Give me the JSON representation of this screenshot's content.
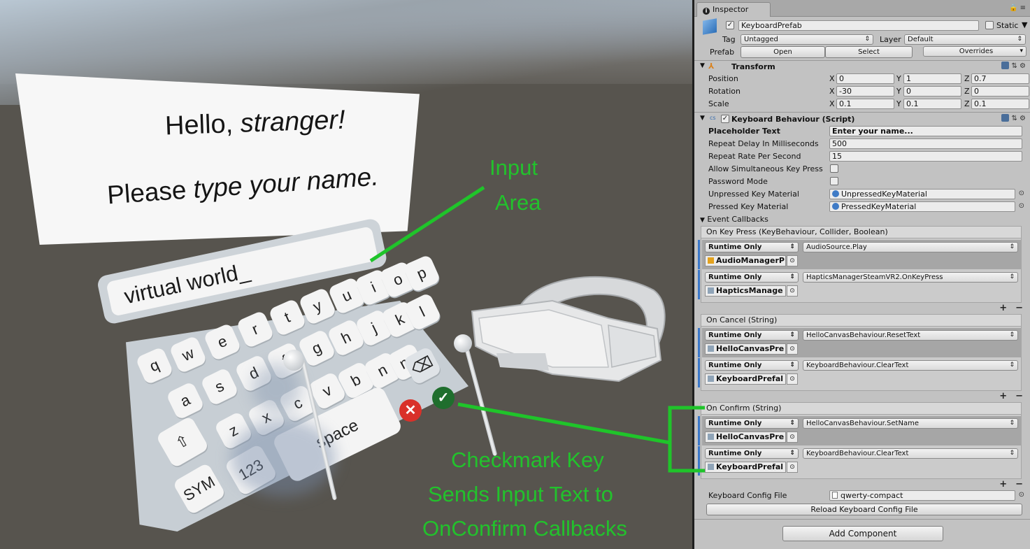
{
  "scene": {
    "hello_title_plain": "Hello, ",
    "hello_title_italic": "stranger!",
    "hello_sub_plain": "Please ",
    "hello_sub_rest": "type your name.",
    "input_text": "virtual world_",
    "keys": [
      "q",
      "w",
      "e",
      "r",
      "t",
      "y",
      "u",
      "i",
      "o",
      "p",
      "a",
      "s",
      "d",
      "f",
      "g",
      "h",
      "j",
      "k",
      "l",
      "z",
      "x",
      "c",
      "v",
      "b",
      "n",
      "m"
    ],
    "key_space": "space",
    "key_sym": "SYM",
    "key_123": "123",
    "key_shift": "⇧",
    "key_backspace": "⌫",
    "key_cancel": "✕",
    "key_confirm": "✓",
    "annotations": {
      "input_line1": "Input",
      "input_line2": "Area",
      "checkmark_line1": "Checkmark Key",
      "checkmark_line2": "Sends Input Text to",
      "checkmark_line3": "OnConfirm Callbacks"
    },
    "annotation_color": "#22c22c"
  },
  "inspector": {
    "tab_label": "Inspector",
    "object_name": "KeyboardPrefab",
    "static_label": "Static",
    "tag_label": "Tag",
    "tag_value": "Untagged",
    "layer_label": "Layer",
    "layer_value": "Default",
    "prefab_label": "Prefab",
    "prefab_open": "Open",
    "prefab_select": "Select",
    "prefab_overrides": "Overrides",
    "transform": {
      "title": "Transform",
      "position_label": "Position",
      "rotation_label": "Rotation",
      "scale_label": "Scale",
      "axis_x": "X",
      "axis_y": "Y",
      "axis_z": "Z",
      "position": [
        "0",
        "1",
        "0.7"
      ],
      "rotation": [
        "-30",
        "0",
        "0"
      ],
      "scale": [
        "0.1",
        "0.1",
        "0.1"
      ]
    },
    "script": {
      "title": "Keyboard Behaviour (Script)",
      "placeholder_label": "Placeholder Text",
      "placeholder_value": "Enter your name...",
      "repeat_delay_label": "Repeat Delay In Milliseconds",
      "repeat_delay_value": "500",
      "repeat_rate_label": "Repeat Rate Per Second",
      "repeat_rate_value": "15",
      "allow_simul_label": "Allow Simultaneous Key Press",
      "password_label": "Password Mode",
      "unpressed_label": "Unpressed Key Material",
      "unpressed_value": "UnpressedKeyMaterial",
      "pressed_label": "Pressed Key Material",
      "pressed_value": "PressedKeyMaterial",
      "event_callbacks_label": "Event Callbacks",
      "config_label": "Keyboard Config File",
      "config_value": "qwerty-compact",
      "reload_button": "Reload Keyboard Config File"
    },
    "events": [
      {
        "header": "On Key Press (KeyBehaviour, Collider, Boolean)",
        "entries": [
          {
            "mode": "Runtime Only",
            "function": "AudioSource.Play",
            "object": "AudioManagerP"
          },
          {
            "mode": "Runtime Only",
            "function": "HapticsManagerSteamVR2.OnKeyPress",
            "object": "HapticsManage"
          }
        ]
      },
      {
        "header": "On Cancel (String)",
        "entries": [
          {
            "mode": "Runtime Only",
            "function": "HelloCanvasBehaviour.ResetText",
            "object": "HelloCanvasPre"
          },
          {
            "mode": "Runtime Only",
            "function": "KeyboardBehaviour.ClearText",
            "object": "KeyboardPrefal"
          }
        ]
      },
      {
        "header": "On Confirm (String)",
        "entries": [
          {
            "mode": "Runtime Only",
            "function": "HelloCanvasBehaviour.SetName",
            "object": "HelloCanvasPre"
          },
          {
            "mode": "Runtime Only",
            "function": "KeyboardBehaviour.ClearText",
            "object": "KeyboardPrefal"
          }
        ]
      }
    ],
    "plus": "+",
    "minus": "−",
    "add_component": "Add Component"
  }
}
